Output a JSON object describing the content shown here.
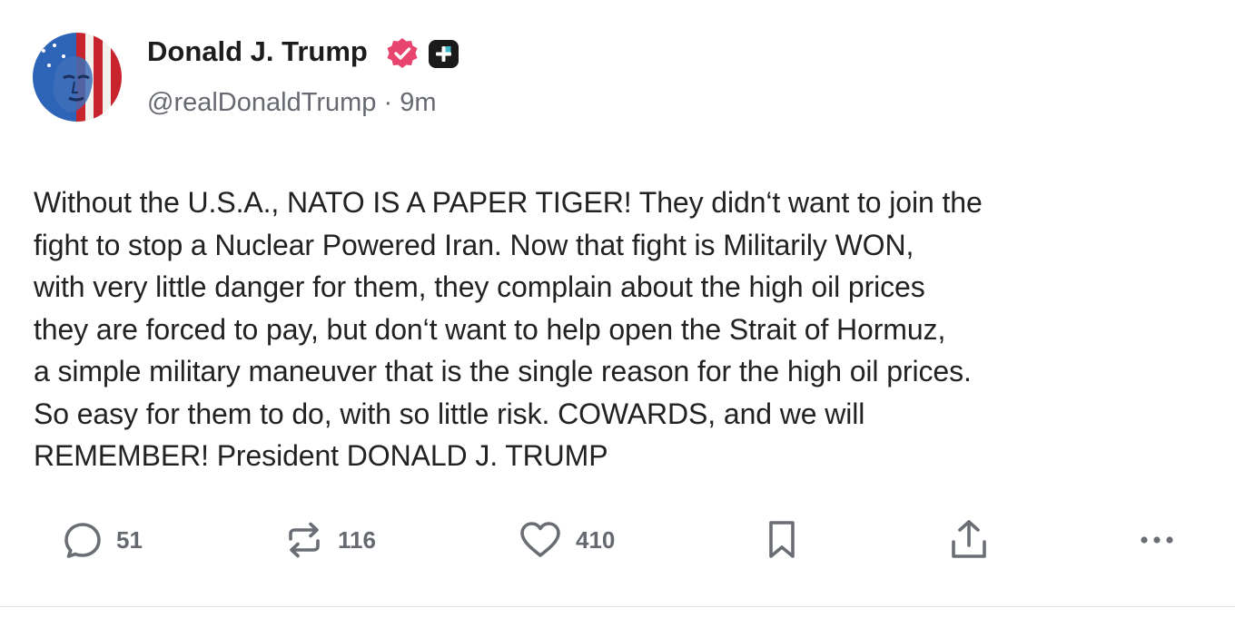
{
  "author": {
    "display_name": "Donald J. Trump",
    "handle": "@realDonaldTrump",
    "separator": "·",
    "time_ago": "9m",
    "verified_badge_color": "#e8456e",
    "plus_badge_color": "#1a1a1a"
  },
  "post": {
    "text": "Without the U.S.A., NATO IS A PAPER TIGER! They didn‘t want to join the\nfight to stop a Nuclear Powered Iran. Now that fight is Militarily WON,\nwith very little danger for them, they complain about the high oil prices\nthey are forced to pay, but don‘t want to help open the Strait of Hormuz,\na simple military maneuver that is the single reason for the high oil prices.\nSo easy for them to do, with so little risk. COWARDS, and we will\nREMEMBER! President DONALD J. TRUMP"
  },
  "actions": {
    "reply": {
      "icon": "reply-bubble-icon",
      "count": "51"
    },
    "repost": {
      "icon": "repost-icon",
      "count": "116"
    },
    "like": {
      "icon": "heart-icon",
      "count": "410"
    },
    "bookmark": {
      "icon": "bookmark-icon"
    },
    "share": {
      "icon": "share-upload-icon"
    },
    "more": {
      "icon": "more-dots-icon"
    }
  },
  "colors": {
    "text_primary": "#222222",
    "text_secondary": "#666a70",
    "divider": "#e2e2e2"
  }
}
